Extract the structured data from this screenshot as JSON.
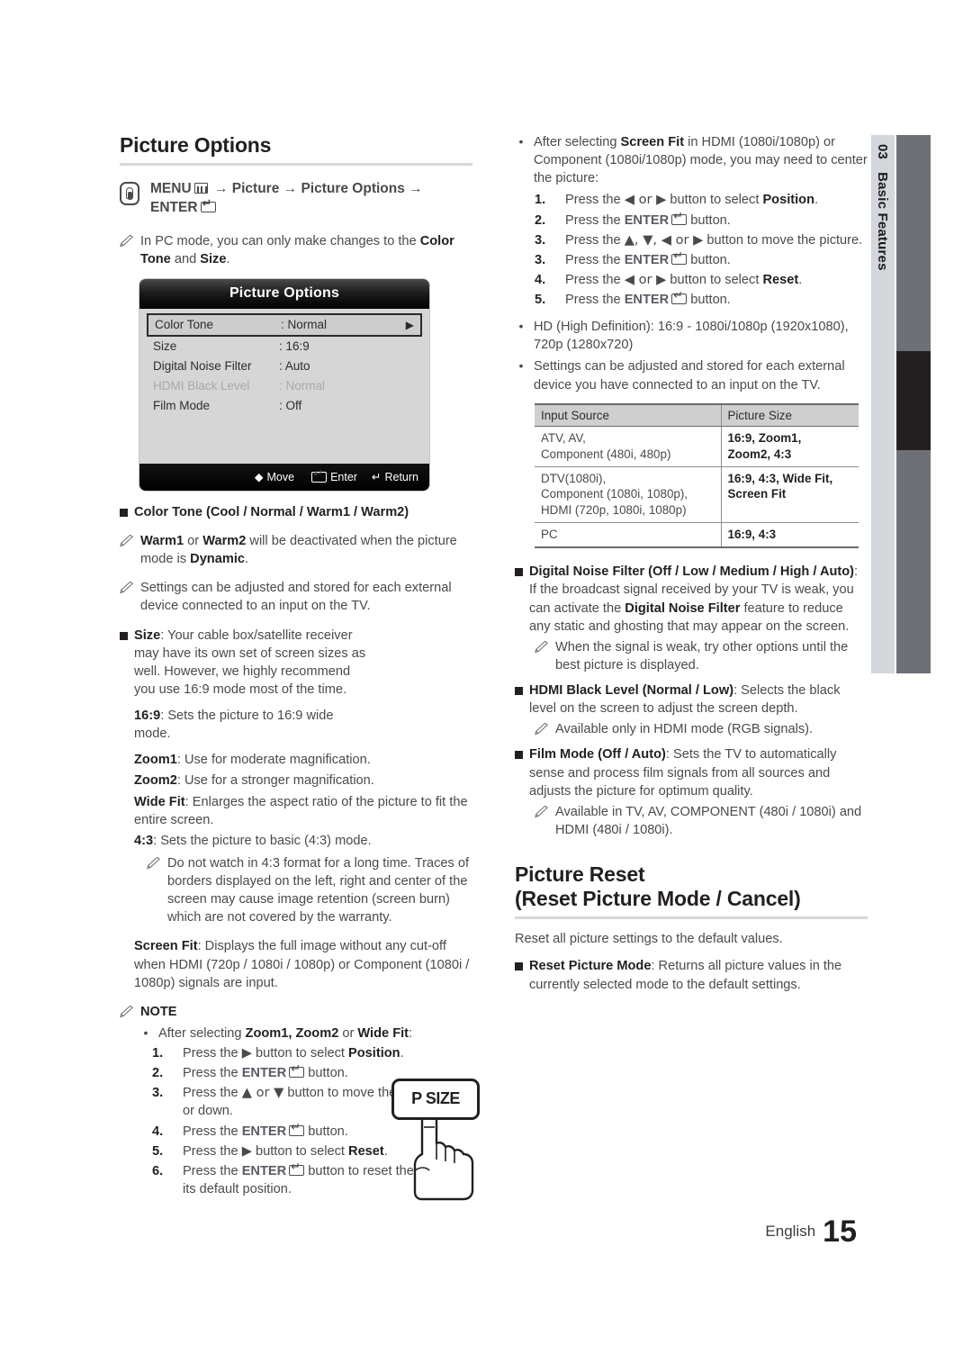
{
  "sidebar": {
    "chapter_number": "03",
    "chapter_title": "Basic Features"
  },
  "footer": {
    "language": "English",
    "page_number": "15"
  },
  "left": {
    "heading": "Picture Options",
    "menu_path": {
      "menu_label": "MENU",
      "arrow1": "→",
      "item1": "Picture",
      "arrow2": "→",
      "item2": "Picture Options",
      "arrow3": "→",
      "enter_label": "ENTER"
    },
    "pc_note": {
      "part1": "In PC mode, you can only make changes to the ",
      "bold1": "Color Tone",
      "part2": " and ",
      "bold2": "Size",
      "part3": "."
    },
    "osd": {
      "title": "Picture Options",
      "rows": [
        {
          "label": "Color Tone",
          "value": ": Normal",
          "selected": true,
          "dim": false,
          "arrow": "▶"
        },
        {
          "label": "Size",
          "value": ": 16:9",
          "selected": false,
          "dim": false,
          "arrow": ""
        },
        {
          "label": "Digital Noise Filter",
          "value": ": Auto",
          "selected": false,
          "dim": false,
          "arrow": ""
        },
        {
          "label": "HDMI Black Level",
          "value": ": Normal",
          "selected": false,
          "dim": true,
          "arrow": ""
        },
        {
          "label": "Film Mode",
          "value": ": Off",
          "selected": false,
          "dim": false,
          "arrow": ""
        }
      ],
      "footer": {
        "move": "Move",
        "enter": "Enter",
        "return": "Return"
      }
    },
    "color_tone_heading": "Color Tone (Cool / Normal / Warm1 / Warm2)",
    "note_warm": {
      "b1": "Warm1",
      "t1": " or ",
      "b2": "Warm2",
      "t2": " will be deactivated when the picture mode is ",
      "b3": "Dynamic",
      "t3": "."
    },
    "note_settings": "Settings can be adjusted and stored for each external device connected to an input on the TV.",
    "size_block": {
      "bold": "Size",
      "text": ": Your cable box/satellite receiver may have its own set of screen sizes as well. However, we highly recommend you use 16:9 mode most of the time.",
      "items": [
        {
          "b": "16:9",
          "t": ": Sets the picture to 16:9 wide mode."
        },
        {
          "b": "Zoom1",
          "t": ": Use for moderate magnification."
        },
        {
          "b": "Zoom2",
          "t": ": Use for a stronger magnification."
        },
        {
          "b": "Wide Fit",
          "t": ": Enlarges the aspect ratio of the picture to fit the entire screen."
        },
        {
          "b": "4:3",
          "t": ": Sets the picture to basic (4:3) mode."
        }
      ],
      "note_43": "Do not watch in 4:3 format for a long time. Traces of borders displayed on the left, right and center of the screen may cause image retention (screen burn) which are not covered by the warranty.",
      "screen_fit_bold": "Screen Fit",
      "screen_fit_text": ": Displays the full image without any cut-off when HDMI (720p / 1080i / 1080p) or Component (1080i / 1080p) signals are input."
    },
    "psize_button_label": "P SIZE",
    "note_heading": "NOTE",
    "note_bullet": {
      "t1": "After selecting ",
      "b1": "Zoom1, Zoom2",
      "t2": " or ",
      "b2": "Wide Fit",
      "t3": ":"
    },
    "note_steps": [
      {
        "num": "1.",
        "pre": "Press the ",
        "key": "▶",
        "mid": " button to select ",
        "bold": "Position",
        "post": "."
      },
      {
        "num": "2.",
        "pre": "Press the ",
        "key": "ENTER",
        "mid": " button.",
        "bold": "",
        "post": ""
      },
      {
        "num": "3.",
        "pre": "Press the ",
        "key": "▲ or ▼",
        "mid": " button to move the picture up or down.",
        "bold": "",
        "post": ""
      },
      {
        "num": "4.",
        "pre": "Press the ",
        "key": "ENTER",
        "mid": " button.",
        "bold": "",
        "post": ""
      },
      {
        "num": "5.",
        "pre": "Press the ",
        "key": "▶",
        "mid": " button to select ",
        "bold": "Reset",
        "post": "."
      },
      {
        "num": "6.",
        "pre": "Press the ",
        "key": "ENTER",
        "mid": " button to reset the picture to its default position.",
        "bold": "",
        "post": ""
      }
    ]
  },
  "right": {
    "screen_fit_bullet": {
      "t1": "After selecting ",
      "b1": "Screen Fit",
      "t2": " in HDMI (1080i/1080p) or Component (1080i/1080p) mode, you may need to center the picture:"
    },
    "center_steps": [
      {
        "num": "1.",
        "pre": "Press the ",
        "key": "◀ or ▶",
        "mid": " button to select ",
        "bold": "Position",
        "post": "."
      },
      {
        "num": "2.",
        "pre": "Press the ",
        "key": "ENTER",
        "mid": " button.",
        "bold": "",
        "post": ""
      },
      {
        "num": "3.",
        "pre": "Press the ",
        "key": "▲, ▼, ◀ or ▶",
        "mid": " button to move the picture.",
        "bold": "",
        "post": ""
      },
      {
        "num": "3.",
        "pre": "Press the ",
        "key": "ENTER",
        "mid": " button.",
        "bold": "",
        "post": ""
      },
      {
        "num": "4.",
        "pre": "Press the ",
        "key": "◀ or ▶",
        "mid": " button to select ",
        "bold": "Reset",
        "post": "."
      },
      {
        "num": "5.",
        "pre": "Press the ",
        "key": "ENTER",
        "mid": " button.",
        "bold": "",
        "post": ""
      }
    ],
    "hd_bullet": "HD (High Definition): 16:9 - 1080i/1080p (1920x1080), 720p (1280x720)",
    "settings_bullet": "Settings can be adjusted and stored for each external device you have connected to an input on the TV.",
    "table": {
      "headers": [
        "Input Source",
        "Picture Size"
      ],
      "rows": [
        {
          "source": "ATV, AV,\nComponent (480i, 480p)",
          "size": "16:9, Zoom1,\nZoom2, 4:3"
        },
        {
          "source": "DTV(1080i),\nComponent (1080i, 1080p),\nHDMI (720p, 1080i, 1080p)",
          "size": "16:9, 4:3, Wide Fit,\nScreen Fit"
        },
        {
          "source": "PC",
          "size": "16:9, 4:3"
        }
      ]
    },
    "dnf": {
      "bold": "Digital Noise Filter (Off / Low / Medium / High / Auto)",
      "t1": ": If the broadcast signal received by your TV is weak, you can activate the ",
      "b2": "Digital Noise Filter",
      "t2": " feature to reduce any static and ghosting that may appear on the screen."
    },
    "dnf_note": "When the signal is weak, try other options until the best picture is displayed.",
    "hdmi_black": {
      "bold": "HDMI Black Level (Normal / Low)",
      "text": ": Selects the black level on the screen to adjust the screen depth."
    },
    "hdmi_black_note": "Available only in HDMI mode (RGB signals).",
    "film_mode": {
      "bold": "Film Mode (Off / Auto)",
      "text": ": Sets the TV to automatically sense and process film signals from all sources and adjusts the picture for optimum quality."
    },
    "film_mode_note": "Available in TV, AV, COMPONENT (480i / 1080i) and HDMI (480i / 1080i).",
    "reset_heading_line1": "Picture Reset",
    "reset_heading_line2": "(Reset Picture Mode / Cancel)",
    "reset_intro": "Reset all picture settings to the default values.",
    "reset_item": {
      "bold": "Reset Picture Mode",
      "text": ": Returns all picture values in the currently selected mode to the default settings."
    }
  }
}
